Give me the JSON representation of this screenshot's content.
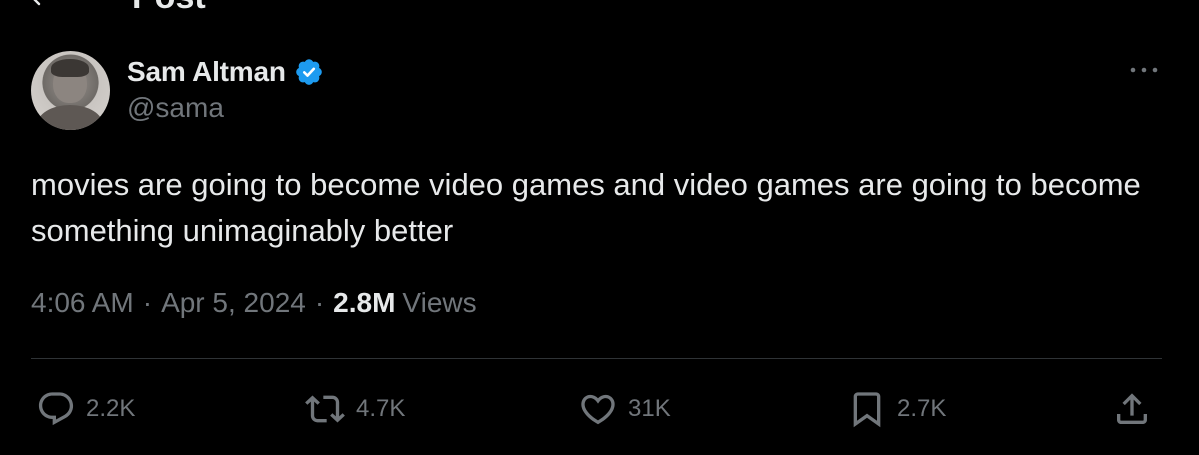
{
  "header": {
    "title": "Post"
  },
  "author": {
    "name": "Sam Altman",
    "handle": "@sama",
    "verified": true
  },
  "tweet": {
    "text": "movies are going to become video games and video games are going to become something unimaginably better",
    "time": "4:06 AM",
    "date": "Apr 5, 2024",
    "separator": "·",
    "views_count": "2.8M",
    "views_label": "Views"
  },
  "actions": {
    "replies": "2.2K",
    "reposts": "4.7K",
    "likes": "31K",
    "bookmarks": "2.7K"
  },
  "colors": {
    "background": "#000000",
    "text_primary": "#e7e9ea",
    "text_secondary": "#71767b",
    "verified": "#1d9bf0",
    "divider": "#2f3336"
  },
  "icons": {
    "back": "arrow-left-icon",
    "verified": "verified-badge-icon",
    "more": "more-horizontal-icon",
    "reply": "reply-icon",
    "repost": "repost-icon",
    "like": "heart-icon",
    "bookmark": "bookmark-icon",
    "share": "share-icon"
  }
}
